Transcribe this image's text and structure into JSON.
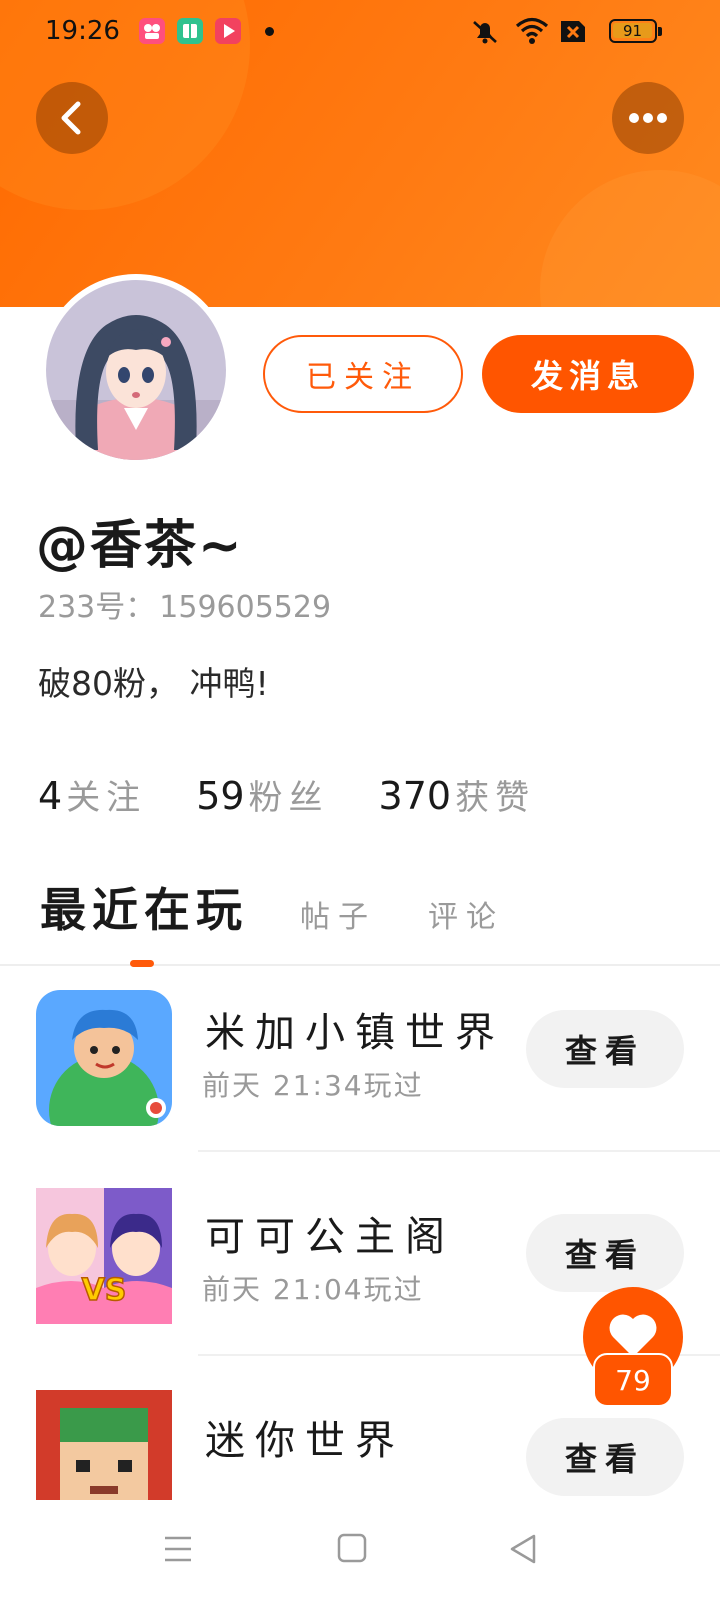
{
  "status_bar": {
    "time": "19:26",
    "battery": "91"
  },
  "profile": {
    "username": "@香茶~",
    "id_label": "233号：",
    "id_value": "159605529",
    "bio": "破80粉， 冲鸭!",
    "follow_label": "已关注",
    "message_label": "发消息"
  },
  "stats": [
    {
      "value": "4",
      "label": "关注"
    },
    {
      "value": "59",
      "label": "粉丝"
    },
    {
      "value": "370",
      "label": "获赞"
    }
  ],
  "tabs": [
    {
      "label": "最近在玩",
      "active": true
    },
    {
      "label": "帖子",
      "active": false
    },
    {
      "label": "评论",
      "active": false
    }
  ],
  "games": [
    {
      "name": "米加小镇世界",
      "played": "前天 21:34玩过",
      "action": "查看",
      "icon": "town-world-icon"
    },
    {
      "name": "可可公主阁",
      "played": "前天 21:04玩过",
      "action": "查看",
      "icon": "princess-vs-icon"
    },
    {
      "name": "迷你世界",
      "played": "",
      "action": "查看",
      "icon": "mini-world-icon"
    }
  ],
  "like": {
    "count": "79"
  },
  "colors": {
    "accent": "#ff5500",
    "header_gradient_start": "#ff6a00",
    "header_gradient_end": "#ff8a1f",
    "muted_text": "#9a9a9a"
  }
}
